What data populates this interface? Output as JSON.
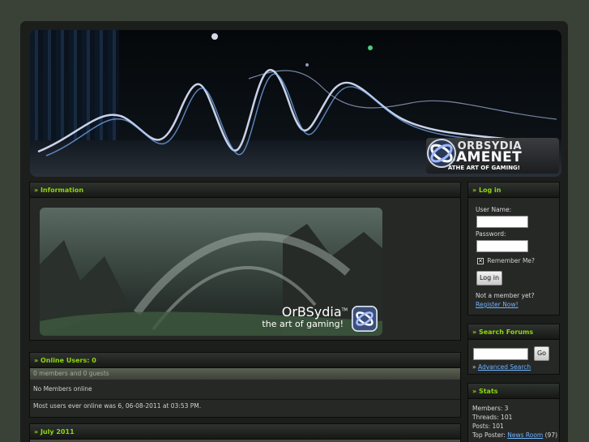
{
  "banner": {
    "brand_top": "ORBSYDIA",
    "brand_main": "GAMENET",
    "tagline": "ATHE ART OF GAMING!"
  },
  "information": {
    "title": "» Information",
    "art_brand": "OrBSydia",
    "art_tm": "TM",
    "art_tagline": "the art of gaming!"
  },
  "online": {
    "title": "» Online Users: 0",
    "summary": "0 members and 0 guests",
    "members_line": "No Members online",
    "record_line": "Most users ever online was 6, 06-08-2011 at 03:53 PM."
  },
  "calendar": {
    "title": "» July 2011"
  },
  "login": {
    "title": "» Log in",
    "username_label": "User Name:",
    "password_label": "Password:",
    "remember_label": "Remember Me?",
    "login_button": "Log in",
    "not_member": "Not a member yet?",
    "register_link": "Register Now!"
  },
  "search": {
    "title": "» Search Forums",
    "go_button": "Go",
    "advanced_prefix": "»",
    "advanced_link": "Advanced Search"
  },
  "stats": {
    "title": "» Stats",
    "members": "Members: 3",
    "threads": "Threads: 101",
    "posts": "Posts: 101",
    "top_poster_label": "Top Poster:",
    "top_poster_name": "News Room",
    "top_poster_count": "(97)"
  },
  "colors": {
    "accent_green": "#8ed60a",
    "link_blue": "#6fb3ff",
    "background": "#3a4238"
  }
}
